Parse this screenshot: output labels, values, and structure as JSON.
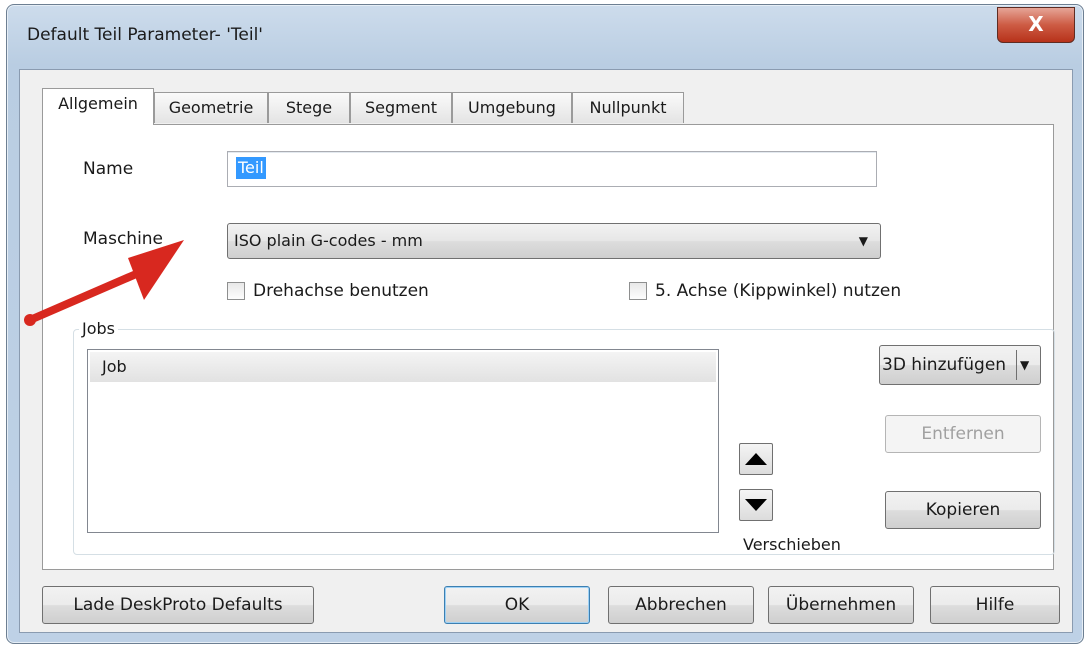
{
  "window": {
    "title": "Default Teil Parameter- 'Teil'",
    "close_label": "X"
  },
  "tabs": [
    {
      "label": "Allgemein"
    },
    {
      "label": "Geometrie"
    },
    {
      "label": "Stege"
    },
    {
      "label": "Segment"
    },
    {
      "label": "Umgebung"
    },
    {
      "label": "Nullpunkt"
    }
  ],
  "form": {
    "name_label": "Name",
    "name_value": "Teil",
    "machine_label": "Maschine",
    "machine_value": "ISO plain G-codes - mm",
    "rotary_axis_label": "Drehachse benutzen",
    "rotary_axis_checked": false,
    "fifth_axis_label": "5. Achse (Kippwinkel) nutzen",
    "fifth_axis_checked": false
  },
  "jobs": {
    "group_label": "Jobs",
    "items": [
      {
        "label": "Job"
      }
    ],
    "add_label": "3D hinzufügen",
    "remove_label": "Entfernen",
    "move_label": "Verschieben",
    "copy_label": "Kopieren"
  },
  "footer": {
    "defaults_label": "Lade DeskProto Defaults",
    "ok_label": "OK",
    "cancel_label": "Abbrechen",
    "apply_label": "Übernehmen",
    "help_label": "Hilfe"
  },
  "annotation": {
    "arrow_color": "#d8281f"
  }
}
